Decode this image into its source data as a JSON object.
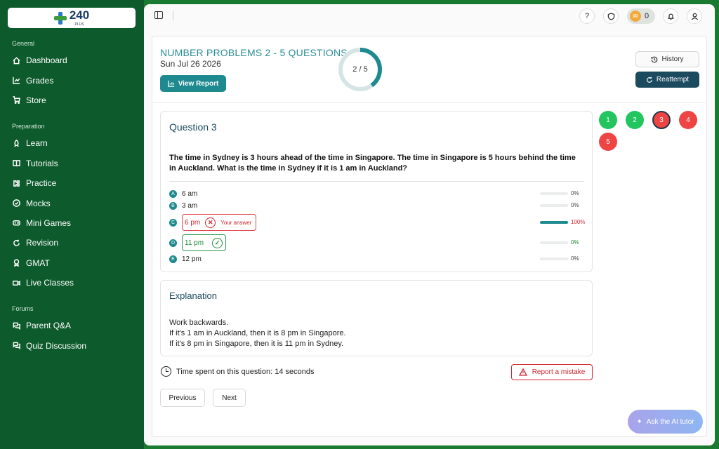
{
  "brand": {
    "name": "240",
    "sub": "PLUS"
  },
  "sidebar": {
    "sections": [
      {
        "title": "General",
        "items": [
          {
            "label": "Dashboard",
            "icon": "home-icon"
          },
          {
            "label": "Grades",
            "icon": "chart-icon"
          },
          {
            "label": "Store",
            "icon": "cart-icon"
          }
        ]
      },
      {
        "title": "Preparation",
        "items": [
          {
            "label": "Learn",
            "icon": "rocket-icon"
          },
          {
            "label": "Tutorials",
            "icon": "book-icon"
          },
          {
            "label": "Practice",
            "icon": "puzzle-icon"
          },
          {
            "label": "Mocks",
            "icon": "check-circle-icon"
          },
          {
            "label": "Mini Games",
            "icon": "gamepad-icon"
          },
          {
            "label": "Revision",
            "icon": "refresh-icon"
          },
          {
            "label": "GMAT",
            "icon": "award-icon"
          },
          {
            "label": "Live Classes",
            "icon": "video-icon"
          }
        ]
      },
      {
        "title": "Forums",
        "items": [
          {
            "label": "Parent Q&A",
            "icon": "chat-icon"
          },
          {
            "label": "Quiz Discussion",
            "icon": "chat-icon"
          }
        ]
      }
    ]
  },
  "topbar": {
    "coins": "0"
  },
  "quiz": {
    "title": "NUMBER PROBLEMS 2 - 5 QUESTIONS",
    "date": "Sun Jul 26 2026",
    "view_report": "View Report",
    "progress_label": "2 / 5",
    "progress_fraction": 0.4,
    "history": "History",
    "reattempt": "Reattempt"
  },
  "question": {
    "heading": "Question 3",
    "text": "The time in Sydney is 3 hours ahead of the time in Singapore. The time in Singapore is 5 hours behind the time in Auckland. What is the time in Sydney if it is 1 am in Auckland?",
    "your_answer_label": "Your answer",
    "options": [
      {
        "letter": "A",
        "text": "6 am",
        "pct": "0%",
        "value": 0
      },
      {
        "letter": "B",
        "text": "3 am",
        "pct": "0%",
        "value": 0
      },
      {
        "letter": "C",
        "text": "6 pm",
        "pct": "100%",
        "value": 1
      },
      {
        "letter": "D",
        "text": "11 pm",
        "pct": "0%",
        "value": 0
      },
      {
        "letter": "E",
        "text": "12 pm",
        "pct": "0%",
        "value": 0
      }
    ]
  },
  "explanation": {
    "heading": "Explanation",
    "lines": [
      "Work backwards.",
      "If it's 1 am in Auckland, then it is 8 pm in Singapore.",
      "If it's 8 pm in Singapore, then it is 11 pm in Sydney."
    ]
  },
  "footer": {
    "time_spent": "Time spent on this question: 14 seconds",
    "report_mistake": "Report a mistake",
    "previous": "Previous",
    "next": "Next",
    "ai_tutor": "Ask the AI tutor"
  },
  "question_nav": [
    {
      "n": "1",
      "status": "correct",
      "color": "#22c55e"
    },
    {
      "n": "2",
      "status": "correct",
      "color": "#22c55e"
    },
    {
      "n": "3",
      "status": "current-wrong",
      "color": "#ef4444"
    },
    {
      "n": "4",
      "status": "wrong",
      "color": "#ef4444"
    },
    {
      "n": "5",
      "status": "wrong",
      "color": "#ef4444"
    }
  ],
  "colors": {
    "accent": "#1e8a8f",
    "sidebar": "#0d5a2c",
    "correct": "#22c55e",
    "wrong": "#ef4444",
    "dark_button": "#1c4a5e"
  }
}
